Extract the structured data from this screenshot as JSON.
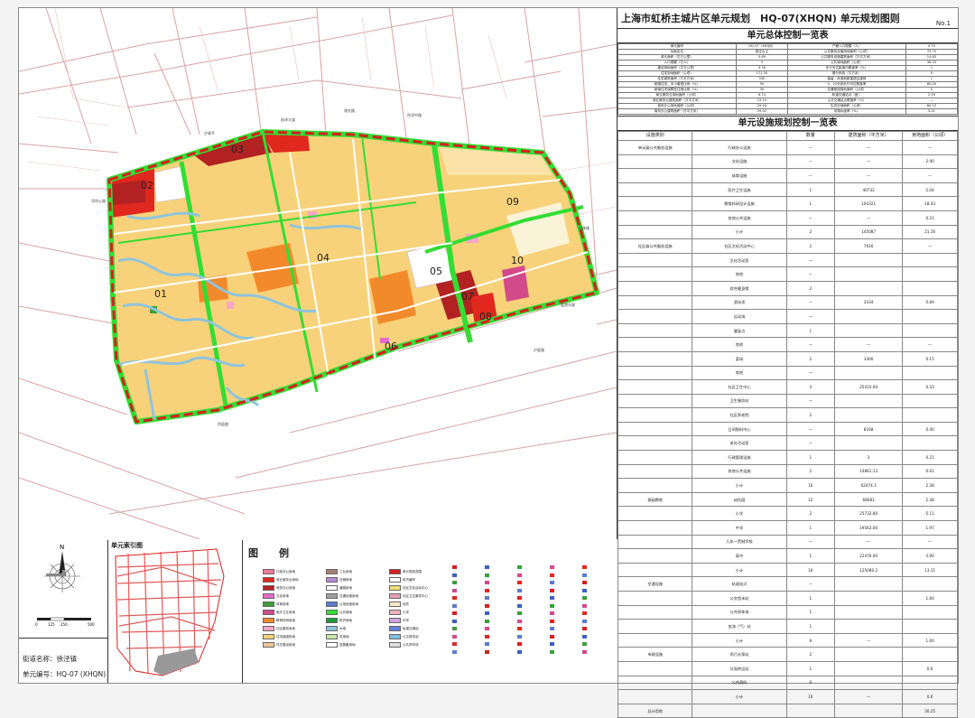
{
  "panel": {
    "title": "上海市虹桥主城片区单元规划　HQ-07(XHQN) 单元规划图则",
    "number": "No.1",
    "overall_title": "单元总体控制一览表",
    "facility_title": "单元设施规划控制一览表"
  },
  "overall_rows": [
    [
      "单元编号",
      "HQ-07（XHQN）",
      "户籍人口规模（人）",
      "4.70"
    ],
    [
      "功能定位",
      "居住为主",
      "公共服务设施用地面积（公顷）",
      "70.75"
    ],
    [
      "单元面积（平方公里）",
      "5.69",
      "公共服务设施建筑面积（万平方米）",
      "14.83"
    ],
    [
      "人口规模（万人）",
      "3",
      "公共绿地面积（公顷）",
      "36.20"
    ],
    [
      "建设用地面积（平方公里）",
      "3.76",
      "步行可达距离内覆盖率（%）",
      "1"
    ],
    [
      "住宅用地面积（公顷）",
      "171.30",
      "慢行系统（平方米）",
      "0"
    ],
    [
      "住宅建筑面积（万平方米）",
      "330",
      "保留、改造和新建居住建筑",
      "1"
    ],
    [
      "新增住宅、中小套型比例（%）",
      "90",
      "5、10分钟步行可达覆盖率",
      "80.00"
    ],
    [
      "新增住宅保障性住房比例（%）",
      "30",
      "交通枢纽用地面积（公顷）",
      "0"
    ],
    [
      "商业服务业用地面积（公顷）",
      "6.74",
      "轨道交通站点（座）",
      "2.59"
    ],
    [
      "商业服务业建筑面积（万平方米）",
      "23.14",
      "公共交通站点覆盖率（%）",
      "—"
    ],
    [
      "商务办公用地面积（公顷）",
      "29.54",
      "生态空间面积（公顷）",
      "60.13"
    ],
    [
      "商务办公建筑面积（万平方米）",
      "29.02",
      "河湖水面率（%）",
      "3.51"
    ]
  ],
  "facility_header": [
    "设施类别",
    "",
    "数量",
    "建筑面积（平方米）",
    "用地面积（公顷）"
  ],
  "facility_rows": [
    [
      "单元级公共服务设施",
      "行政办公设施",
      "—",
      "—",
      "—"
    ],
    [
      "",
      "文化设施",
      "—",
      "—",
      "2.90"
    ],
    [
      "",
      "体育设施",
      "—",
      "—",
      "—"
    ],
    [
      "",
      "医疗卫生设施",
      "1",
      "40732",
      "2.04"
    ],
    [
      "",
      "教育科研设计设施",
      "1",
      "104321",
      "18.43"
    ],
    [
      "",
      "其他公共设施",
      "—",
      "—",
      "0.21"
    ],
    [
      "",
      "小计",
      "2",
      "145087",
      "21.16"
    ],
    [
      "社区级公共服务设施",
      "社区文化活动中心",
      "2",
      "7616",
      "—"
    ],
    [
      "",
      "文化活动室",
      "—",
      "",
      ""
    ],
    [
      "",
      "其他",
      "—",
      "",
      ""
    ],
    [
      "",
      "综合健身馆",
      "2",
      "",
      ""
    ],
    [
      "",
      "游泳池",
      "—",
      "3334",
      "0.84"
    ],
    [
      "",
      "运动场",
      "—",
      "",
      ""
    ],
    [
      "",
      "健身点",
      "1",
      "",
      ""
    ],
    [
      "",
      "其他",
      "—",
      "—",
      "—"
    ],
    [
      "",
      "菜场",
      "2",
      "3300",
      "0.15"
    ],
    [
      "",
      "其他",
      "—",
      "",
      ""
    ],
    [
      "",
      "社区卫生中心",
      "3",
      "25410.00",
      "0.33"
    ],
    [
      "",
      "卫生服务站",
      "—",
      "",
      ""
    ],
    [
      "",
      "社区养老院",
      "2",
      "",
      ""
    ],
    [
      "",
      "日间照料中心",
      "—",
      "8168",
      "0.40"
    ],
    [
      "",
      "老年活动室",
      "—",
      "",
      ""
    ],
    [
      "",
      "行政管理设施",
      "1",
      "3",
      "0.21"
    ],
    [
      "",
      "其他公共设施",
      "2",
      "14861.13",
      "0.61"
    ],
    [
      "",
      "小计",
      "16",
      "62474.1",
      "2.38"
    ],
    [
      "基础教育",
      "幼托园",
      "12",
      "68081",
      "2.38"
    ],
    [
      "",
      "小学",
      "2",
      "25732.80",
      "5.11"
    ],
    [
      "",
      "中学",
      "1",
      "19563.00",
      "1.97"
    ],
    [
      "",
      "九年一贯制学校",
      "—",
      "—",
      "—"
    ],
    [
      "",
      "高中",
      "1",
      "22476.00",
      "3.90"
    ],
    [
      "",
      "小计",
      "16",
      "125080.2",
      "13.11"
    ],
    [
      "交通设施",
      "轨道站点",
      "—",
      "",
      ""
    ],
    [
      "",
      "公交首末站",
      "1",
      "",
      "1.60"
    ],
    [
      "",
      "公共停车场",
      "1",
      "",
      ""
    ],
    [
      "",
      "加油（气）站",
      "1",
      "",
      ""
    ],
    [
      "",
      "小计",
      "8",
      "—",
      "1.60"
    ],
    [
      "市政设施",
      "雨污水泵站",
      "2",
      "",
      ""
    ],
    [
      "",
      "垃圾转运站",
      "1",
      "",
      "0.6"
    ],
    [
      "",
      "公共厕所",
      "6",
      "",
      ""
    ],
    [
      "",
      "小计",
      "10",
      "—",
      "0.6"
    ],
    [
      "总计用地",
      "",
      "",
      "",
      "30.25"
    ]
  ],
  "info": {
    "street_label": "街道名称：",
    "street": "徐泾镇",
    "unit_label": "单元编号：",
    "unit": "HQ-07 (XHQN)"
  },
  "index_title": "单元索引图",
  "legend_title": "图　例",
  "legend_items": [
    {
      "label": "行政办公用地",
      "color": "#f07a9a"
    },
    {
      "label": "商业服务业用地",
      "color": "#e0281f"
    },
    {
      "label": "商务办公用地",
      "color": "#b22222"
    },
    {
      "label": "文化用地",
      "color": "#e86ac8"
    },
    {
      "label": "体育用地",
      "color": "#3aa03a"
    },
    {
      "label": "医疗卫生用地",
      "color": "#d24a8a"
    },
    {
      "label": "教育科研用地",
      "color": "#f28a2c"
    },
    {
      "label": "社区服务用地",
      "color": "#f7a6c6"
    },
    {
      "label": "住宅组团用地",
      "color": "#f8d27a"
    },
    {
      "label": "村庄建设用地",
      "color": "#efc89a"
    },
    {
      "label": "工业用地",
      "color": "#a88070"
    },
    {
      "label": "仓储用地",
      "color": "#b58ad8"
    },
    {
      "label": "道路用地",
      "color": "#ffffff"
    },
    {
      "label": "交通设施用地",
      "color": "#a0a0a0"
    },
    {
      "label": "公用设施用地",
      "color": "#5a7bd0"
    },
    {
      "label": "公共绿地",
      "color": "#33dd33"
    },
    {
      "label": "防护绿地",
      "color": "#1c9a3a"
    },
    {
      "label": "水域",
      "color": "#8fc4dc"
    },
    {
      "label": "农用地",
      "color": "#c8e8a8"
    },
    {
      "label": "发展备用地",
      "color": "#ffffff"
    },
    {
      "label": "单元规划范围",
      "color": "#d81e1e"
    },
    {
      "label": "街坊编号",
      "color": "#ffffff"
    },
    {
      "label": "社区文化活动中心",
      "color": "#f0e070"
    },
    {
      "label": "社区卫生服务中心",
      "color": "#e8a0b8"
    },
    {
      "label": "幼托",
      "color": "#f8e8c8"
    },
    {
      "label": "小学",
      "color": "#f0b0c0"
    },
    {
      "label": "中学",
      "color": "#d0a0e0"
    },
    {
      "label": "轨道交通站",
      "color": "#6080e0"
    },
    {
      "label": "公交首末站",
      "color": "#80c0e0"
    },
    {
      "label": "公共停车场",
      "color": "#e0e0e0"
    }
  ],
  "map": {
    "district_labels": [
      "01",
      "02",
      "03",
      "04",
      "05",
      "06",
      "07",
      "08",
      "09",
      "10"
    ],
    "road_labels": [
      "沪青平",
      "崧泽大道",
      "诸光路",
      "徐泾中路",
      "华徐公路",
      "盈港东路",
      "明珠路",
      "沪星路",
      "徐盈路"
    ]
  },
  "colors": {
    "residential": "#f8d27a",
    "green": "#33dd33",
    "water": "#8fc4dc",
    "commercial": "#e0281f",
    "office": "#b22222",
    "education": "#f28a2c",
    "boundary": "#d81e1e"
  }
}
